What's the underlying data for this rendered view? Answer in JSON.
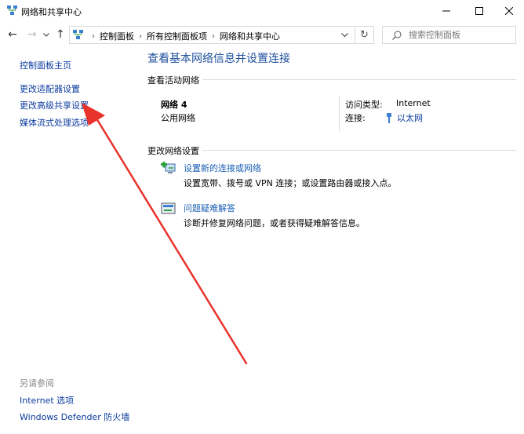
{
  "window": {
    "title": "网络和共享中心",
    "minimize_icon": "minimize-icon",
    "maximize_icon": "maximize-icon",
    "close_icon": "close-icon"
  },
  "navigation": {
    "breadcrumbs": [
      "控制面板",
      "所有控制面板项",
      "网络和共享中心"
    ],
    "search_placeholder": "搜索控制面板"
  },
  "left_pane": {
    "links": [
      "控制面板主页",
      "更改适配器设置",
      "更改高级共享设置",
      "媒体流式处理选项"
    ],
    "see_also_label": "另请参阅",
    "see_also_links": [
      "Internet 选项",
      "Windows Defender 防火墙"
    ]
  },
  "main": {
    "title": "查看基本网络信息并设置连接",
    "active_networks_heading": "查看活动网络",
    "network": {
      "name": "网络 4",
      "type": "公用网络",
      "access_type_label": "访问类型:",
      "access_type_value": "Internet",
      "connections_label": "连接:",
      "connection_value": "以太网"
    },
    "change_settings_heading": "更改网络设置",
    "tasks": [
      {
        "link": "设置新的连接或网络",
        "description": "设置宽带、拨号或 VPN 连接；或设置路由器或接入点。",
        "icon": "new-connection-icon"
      },
      {
        "link": "问题疑难解答",
        "description": "诊断并修复网络问题，或者获得疑难解答信息。",
        "icon": "troubleshoot-icon"
      }
    ]
  },
  "colors": {
    "link": "#0a3a9e",
    "task_link": "#1a5fb4",
    "title": "#1d4f9c",
    "annotation_arrow": "#e8322c"
  }
}
